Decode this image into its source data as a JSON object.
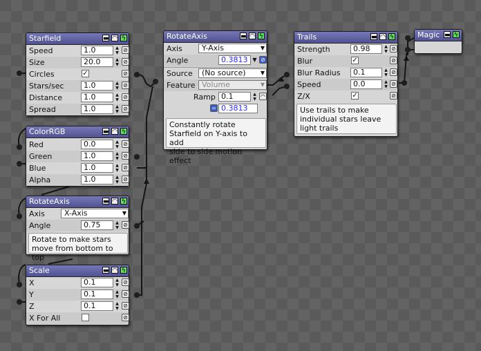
{
  "starfield": {
    "title": "Starfield",
    "rows": [
      {
        "label": "Speed",
        "value": "1.0"
      },
      {
        "label": "Size",
        "value": "20.0"
      },
      {
        "label": "Circles",
        "checked": true
      },
      {
        "label": "Stars/sec",
        "value": "1.0"
      },
      {
        "label": "Distance",
        "value": "1.0"
      },
      {
        "label": "Spread",
        "value": "1.0"
      }
    ]
  },
  "colorrgb": {
    "title": "ColorRGB",
    "rows": [
      {
        "label": "Red",
        "value": "0.0"
      },
      {
        "label": "Green",
        "value": "1.0"
      },
      {
        "label": "Blue",
        "value": "1.0"
      },
      {
        "label": "Alpha",
        "value": "1.0"
      }
    ]
  },
  "rotate1": {
    "title": "RotateAxis",
    "axis_label": "Axis",
    "axis_value": "X-Axis",
    "angle_label": "Angle",
    "angle_value": "0.75",
    "note": [
      "Rotate to make stars",
      "move from bottom to top"
    ]
  },
  "scale": {
    "title": "Scale",
    "rows": [
      {
        "label": "X",
        "value": "0.1"
      },
      {
        "label": "Y",
        "value": "0.1"
      },
      {
        "label": "Z",
        "value": "0.1"
      },
      {
        "label": "X For All",
        "checked": false
      }
    ]
  },
  "rotate2": {
    "title": "RotateAxis",
    "axis_label": "Axis",
    "axis_value": "Y-Axis",
    "angle_label": "Angle",
    "angle_value": "0.3813",
    "source_label": "Source",
    "source_value": "(No source)",
    "feature_label": "Feature",
    "feature_value": "Volume",
    "ramp_label": "Ramp",
    "ramp_value": "0.1",
    "result_value": "0.3813",
    "note": [
      "Constantly rotate",
      "Starfield on Y-axis to add",
      "side to side motion effect"
    ]
  },
  "trails": {
    "title": "Trails",
    "rows": [
      {
        "label": "Strength",
        "value": "0.98"
      },
      {
        "label": "Blur",
        "checked": true
      },
      {
        "label": "Blur Radius",
        "value": "0.1"
      },
      {
        "label": "Speed",
        "value": "0.0"
      },
      {
        "label": "Z/X",
        "checked": true
      }
    ],
    "note": [
      "Use trails to make",
      "individual stars leave",
      "light trails"
    ]
  },
  "magic": {
    "title": "Magic"
  },
  "colors": {
    "header": "#5a5c9e",
    "run": "#5fe05f",
    "link_on": "#3c5ccc",
    "value_blue": "#2a2aff"
  }
}
